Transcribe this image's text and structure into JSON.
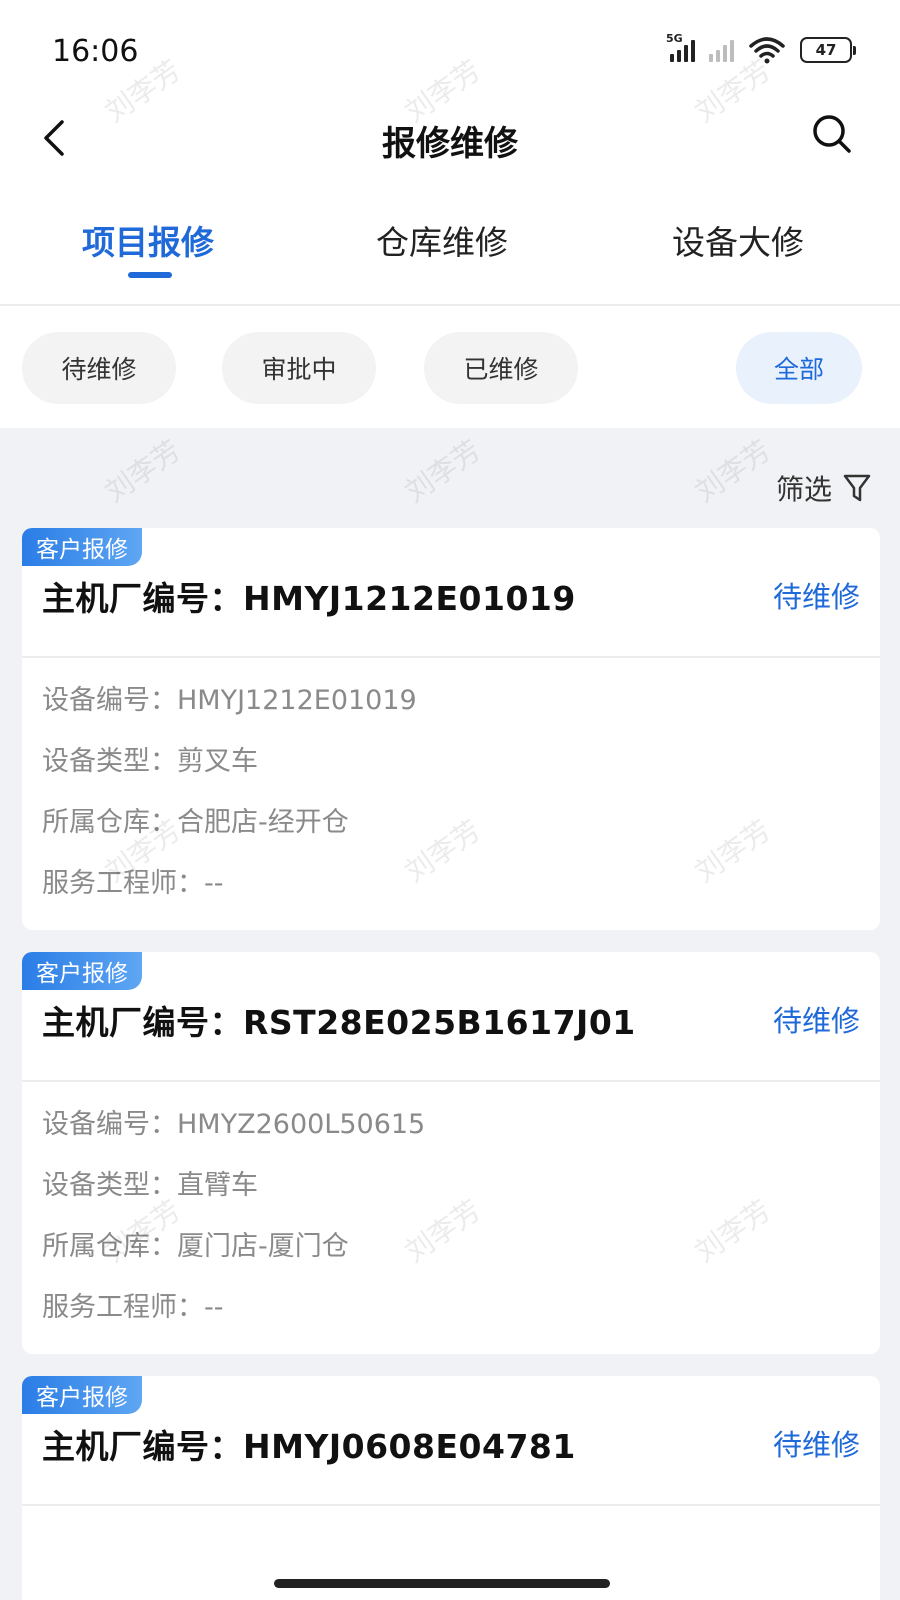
{
  "status_bar": {
    "time": "16:06",
    "network": "5G",
    "battery": "47"
  },
  "header": {
    "title": "报修维修"
  },
  "tabs": [
    {
      "label": "项目报修",
      "active": true
    },
    {
      "label": "仓库维修",
      "active": false
    },
    {
      "label": "设备大修",
      "active": false
    }
  ],
  "chips": [
    {
      "label": "待维修"
    },
    {
      "label": "审批中"
    },
    {
      "label": "已维修"
    },
    {
      "label": "全部",
      "active": true
    }
  ],
  "filter": {
    "label": "筛选"
  },
  "cards": [
    {
      "tag": "客户报修",
      "title": "主机厂编号：HMYJ1212E01019",
      "status": "待维修",
      "fields": [
        "设备编号：HMYJ1212E01019",
        "设备类型：剪叉车",
        "所属仓库：合肥店-经开仓",
        "服务工程师：--"
      ]
    },
    {
      "tag": "客户报修",
      "title": "主机厂编号：RST28E025B1617J01",
      "status": "待维修",
      "fields": [
        "设备编号：HMYZ2600L50615",
        "设备类型：直臂车",
        "所属仓库：厦门店-厦门仓",
        "服务工程师：--"
      ]
    },
    {
      "tag": "客户报修",
      "title": "主机厂编号：HMYJ0608E04781",
      "status": "待维修",
      "fields": []
    }
  ],
  "watermark": "刘李芳",
  "colors": {
    "accent": "#1f6ad8",
    "tag_gradient_start": "#2a7de6",
    "list_background": "#f1f2f5"
  }
}
